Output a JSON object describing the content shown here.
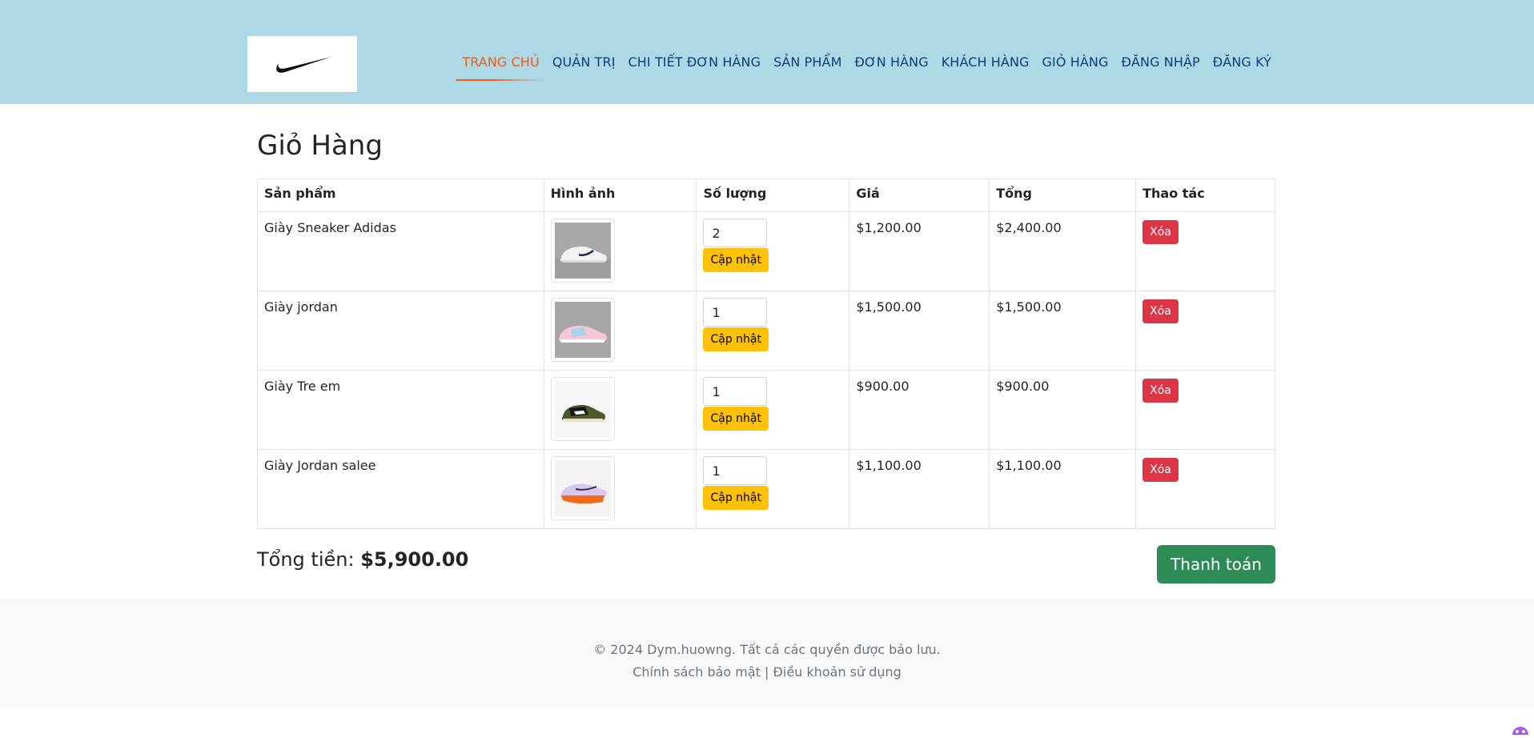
{
  "brand": {
    "logo_icon": "nike-swoosh-icon"
  },
  "nav": [
    {
      "label": "TRANG CHỦ",
      "active": true
    },
    {
      "label": "QUẢN TRỊ",
      "active": false
    },
    {
      "label": "CHI TIẾT ĐƠN HÀNG",
      "active": false
    },
    {
      "label": "SẢN PHẨM",
      "active": false
    },
    {
      "label": "ĐƠN HÀNG",
      "active": false
    },
    {
      "label": "KHÁCH HÀNG",
      "active": false
    },
    {
      "label": "GIỎ HÀNG",
      "active": false
    },
    {
      "label": "ĐĂNG NHẬP",
      "active": false
    },
    {
      "label": "ĐĂNG KÝ",
      "active": false
    }
  ],
  "cart": {
    "title": "Giỏ Hàng",
    "columns": [
      "Sản phẩm",
      "Hình ảnh",
      "Số lượng",
      "Giá",
      "Tổng",
      "Thao tác"
    ],
    "update_label": "Cập nhật",
    "delete_label": "Xóa",
    "rows": [
      {
        "product": "Giày Sneaker Adidas",
        "image": "white-sneaker-navy-swoosh",
        "qty": "2",
        "price": "$1,200.00",
        "total": "$2,400.00"
      },
      {
        "product": "Giày jordan",
        "image": "pink-blue-jordan-sneaker",
        "qty": "1",
        "price": "$1,500.00",
        "total": "$1,500.00"
      },
      {
        "product": "Giày Tre em",
        "image": "olive-black-jordan-low",
        "qty": "1",
        "price": "$900.00",
        "total": "$900.00"
      },
      {
        "product": "Giày Jordan salee",
        "image": "orange-purple-running-shoe",
        "qty": "1",
        "price": "$1,100.00",
        "total": "$1,100.00"
      }
    ],
    "total_label": "Tổng tiền:",
    "total_value": "$5,900.00",
    "checkout_label": "Thanh toán"
  },
  "footer": {
    "copyright": "© 2024 Dym.huowng. Tất cả các quyền được bảo lưu.",
    "privacy": "Chính sách bảo mật",
    "separator": "|",
    "terms": "Điều khoản sử dụng"
  },
  "colors": {
    "header_bg": "#add8e6",
    "nav_active": "#f05a1a",
    "nav": "#0d3c7a",
    "update": "#ffc107",
    "delete": "#dc3545",
    "checkout": "#2e8b57"
  }
}
